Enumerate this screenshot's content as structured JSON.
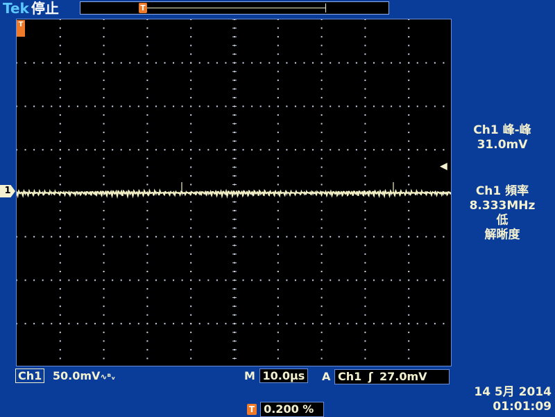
{
  "header": {
    "brand": "Tek",
    "status": "停止"
  },
  "trigger_marker": "T",
  "channel_marker": "1",
  "trigger_level_icon": "left-arrow",
  "measurements": {
    "ch1_pk2pk_label": "Ch1 峰-峰",
    "ch1_pk2pk_value": "31.0mV",
    "ch1_freq_label": "Ch1 頻率",
    "ch1_freq_value": "8.333MHz",
    "ch1_freq_note1": "低",
    "ch1_freq_note2": "解晰度"
  },
  "footer": {
    "ch1_label": "Ch1",
    "ch1_scale": "50.0mV",
    "ch1_bw_icon": "∿ᴮᵥ",
    "timebase_label": "M",
    "timebase_value": "10.0µs",
    "trigger_source_label": "A",
    "trigger_source": "Ch1",
    "trigger_slope": "ʃ",
    "trigger_level": "27.0mV",
    "trig_pos_icon": "T",
    "trig_pos_value": "0.200 %",
    "date": "14 5月  2014",
    "time": "01:01:09"
  },
  "colors": {
    "background": "#0a3d9a",
    "screen": "#000000",
    "trace": "#f2efc4",
    "grid": "#d0d8ea",
    "trigger": "#ef7a2a",
    "text": "#f3f1cf"
  }
}
